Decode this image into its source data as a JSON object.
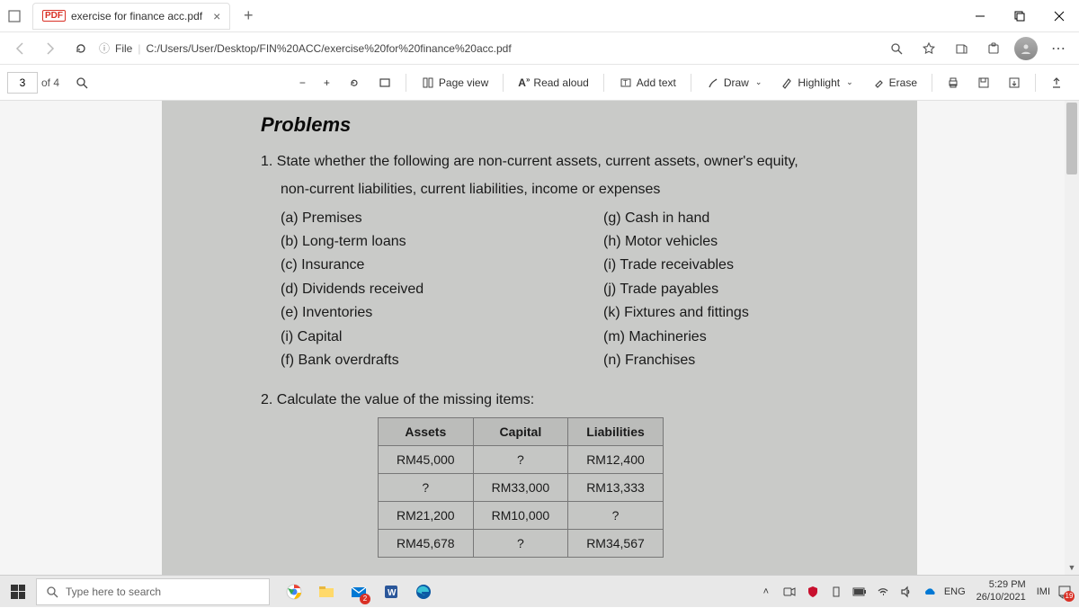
{
  "titlebar": {
    "tab_label": "exercise for finance acc.pdf",
    "file_icon": "PDF"
  },
  "addrbar": {
    "prefix": "File",
    "path": "C:/Users/User/Desktop/FIN%20ACC/exercise%20for%20finance%20acc.pdf"
  },
  "toolbar": {
    "page_current": "3",
    "page_of": "of 4",
    "page_view": "Page view",
    "read_aloud": "Read aloud",
    "add_text": "Add text",
    "draw": "Draw",
    "highlight": "Highlight",
    "erase": "Erase"
  },
  "doc": {
    "heading": "Problems",
    "q1_line1": "1.  State whether the following are non-current assets, current assets, owner's equity,",
    "q1_line2": "non-current liabilities, current liabilities, income or expenses",
    "left": [
      "(a)  Premises",
      "(b)  Long-term loans",
      "(c)  Insurance",
      "(d)  Dividends received",
      "(e)  Inventories",
      "(i)   Capital",
      "(f)   Bank overdrafts"
    ],
    "right": [
      "(g)  Cash in hand",
      "(h)  Motor vehicles",
      "(i)   Trade receivables",
      "(j)   Trade payables",
      "(k)  Fixtures and fittings",
      "(m) Machineries",
      "(n)  Franchises"
    ],
    "q2": "2.  Calculate the value of the missing items:",
    "table": {
      "headers": [
        "Assets",
        "Capital",
        "Liabilities"
      ],
      "rows": [
        [
          "RM45,000",
          "?",
          "RM12,400"
        ],
        [
          "?",
          "RM33,000",
          "RM13,333"
        ],
        [
          "RM21,200",
          "RM10,000",
          "?"
        ],
        [
          "RM45,678",
          "?",
          "RM34,567"
        ]
      ]
    }
  },
  "taskbar": {
    "search_placeholder": "Type here to search",
    "lang": "ENG",
    "time": "5:29 PM",
    "date": "26/10/2021",
    "ime": "IMI",
    "mail_badge": "2",
    "notif_badge": "19"
  }
}
